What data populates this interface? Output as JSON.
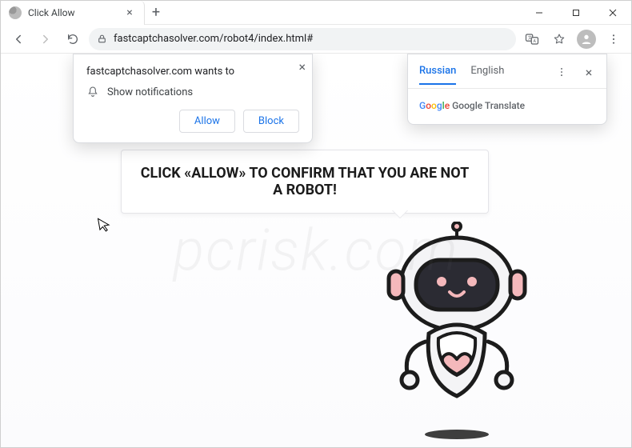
{
  "window": {
    "tab_title": "Click Allow",
    "url": "fastcaptchasolver.com/robot4/index.html#"
  },
  "notification_popup": {
    "title": "fastcaptchasolver.com wants to",
    "permission_label": "Show notifications",
    "allow_label": "Allow",
    "block_label": "Block"
  },
  "translate_popup": {
    "tabs": [
      "Russian",
      "English"
    ],
    "active_tab_index": 0,
    "service_label": "Google Translate"
  },
  "page": {
    "speech_text": "CLICK «ALLOW» TO CONFIRM THAT YOU ARE NOT A ROBOT!"
  },
  "watermark": "pcrisk.com",
  "colors": {
    "accent_blue": "#1a73e8",
    "robot_head": "#2b2b33",
    "robot_body": "#f4f4f6",
    "robot_pink": "#f4b8bb",
    "robot_outline": "#1c1c1c"
  }
}
